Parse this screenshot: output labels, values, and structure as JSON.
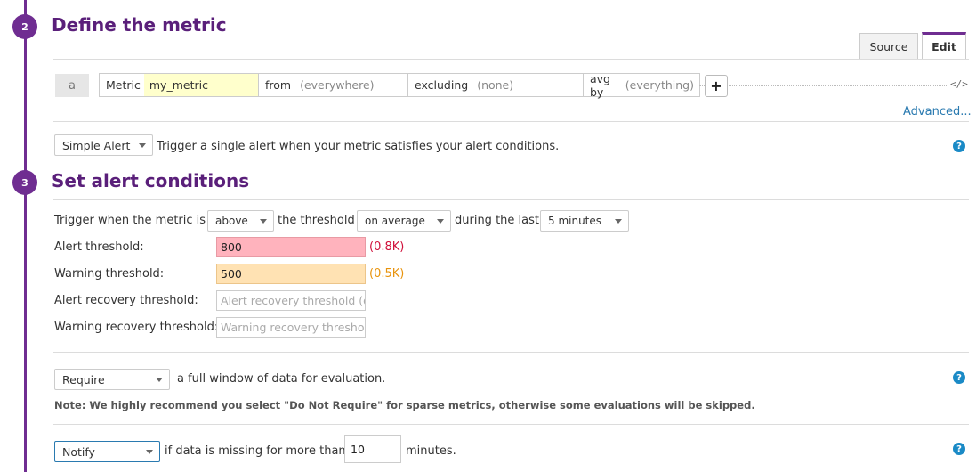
{
  "section2": {
    "number": "2",
    "title": "Define the metric"
  },
  "tabs": [
    {
      "label": "Source"
    },
    {
      "label": "Edit"
    }
  ],
  "query": {
    "letter": "a",
    "metric_label": "Metric",
    "metric_value": "my_metric",
    "from_label": "from",
    "from_value": "(everywhere)",
    "excluding_label": "excluding",
    "excluding_value": "(none)",
    "avgby_label": "avg by",
    "avgby_value": "(everything)",
    "plus_icon": "+",
    "code_icon": "</>"
  },
  "advanced_link": "Advanced...",
  "alert_type": {
    "selected": "Simple Alert",
    "description": "Trigger a single alert when your metric satisfies your alert conditions."
  },
  "section3": {
    "number": "3",
    "title": "Set alert conditions"
  },
  "trigger": {
    "prefix": "Trigger when the metric is",
    "comparator": "above",
    "mid": "the threshold",
    "aggregation": "on average",
    "during": "during the last",
    "window": "5 minutes"
  },
  "thresholds": {
    "alert_label": "Alert threshold:",
    "alert_value": "800",
    "alert_hint": "(0.8K)",
    "warning_label": "Warning threshold:",
    "warning_value": "500",
    "warning_hint": "(0.5K)",
    "alert_recovery_label": "Alert recovery threshold:",
    "alert_recovery_placeholder": "Alert recovery threshold (op",
    "warning_recovery_label": "Warning recovery threshold:",
    "warning_recovery_placeholder": "Warning recovery threshold"
  },
  "require": {
    "selected": "Require",
    "text": "a full window of data for evaluation.",
    "note": "Note: We highly recommend you select \"Do Not Require\" for sparse metrics, otherwise some evaluations will be skipped."
  },
  "notify": {
    "selected": "Notify",
    "prefix": "if data is missing for more than",
    "minutes_value": "10",
    "suffix": "minutes."
  },
  "help_icon": "?",
  "colors": {
    "accent": "#6f2d91",
    "title": "#5a1f7a",
    "alert_bg": "#ffb3bd",
    "warning_bg": "#ffe2b3",
    "alert_text": "#d0103a",
    "warning_text": "#e8930c",
    "link": "#2a7ab0",
    "help": "#1a8ac6"
  }
}
